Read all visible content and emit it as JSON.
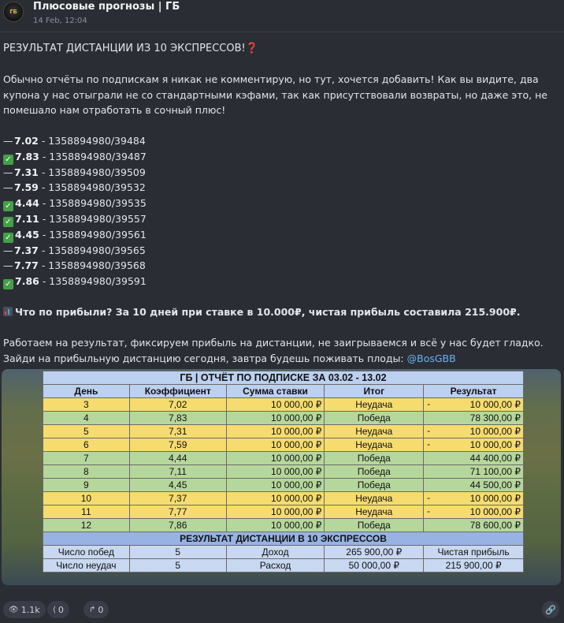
{
  "channel": {
    "title": "Плюсовые прогнозы | ГБ",
    "date": "14 Feb, 12:04",
    "avatar_icon": "channel-logo-icon"
  },
  "post": {
    "headline": "РЕЗУЛЬТАТ ДИСТАНЦИИ ИЗ 10 ЭКСПРЕССОВ!",
    "headline_emoji": "❓",
    "intro": "Обычно отчёты по подпискам я никак не комментирую, но тут, хочется добавить! Как вы видите, два купона у нас отыграли не со стандартными кэфами, так как присутствовали возвраты, но даже это, не помешало нам отработать в сочный плюс!",
    "bets": [
      {
        "status": "dash",
        "mark": "—",
        "coef": "7.02",
        "id": "- 1358894980/39484"
      },
      {
        "status": "check",
        "mark": "✓",
        "coef": "7.83",
        "id": "- 1358894980/39487"
      },
      {
        "status": "dash",
        "mark": "—",
        "coef": "7.31",
        "id": "- 1358894980/39509"
      },
      {
        "status": "dash",
        "mark": "—",
        "coef": "7.59",
        "id": "- 1358894980/39532"
      },
      {
        "status": "check",
        "mark": "✓",
        "coef": "4.44",
        "id": "- 1358894980/39535"
      },
      {
        "status": "check",
        "mark": "✓",
        "coef": "7.11",
        "id": "- 1358894980/39557"
      },
      {
        "status": "check",
        "mark": "✓",
        "coef": "4.45",
        "id": "- 1358894980/39561"
      },
      {
        "status": "dash",
        "mark": "—",
        "coef": "7.37",
        "id": "- 1358894980/39565"
      },
      {
        "status": "dash",
        "mark": "—",
        "coef": "7.77",
        "id": "- 1358894980/39568"
      },
      {
        "status": "check",
        "mark": "✓",
        "coef": "7.86",
        "id": "- 1358894980/39591"
      }
    ],
    "profit_line": "Что по прибыли? За 10 дней при ставке в 10.000₽, чистая прибыль составила 215.900₽.",
    "outro": "Работаем на результат, фиксируем прибыль на дистанции, не заигрываемся и всё у нас будет гладко. Зайди на прибыльную дистанцию сегодня, завтра будешь поживать плоды: ",
    "mention": "@BosGBB"
  },
  "report": {
    "title": "ГБ | ОТЧЁТ ПО ПОДПИСКЕ ЗА 03.02 - 13.02",
    "headers": [
      "День",
      "Коэффициент",
      "Сумма ставки",
      "Итог",
      "Результат"
    ],
    "rows": [
      {
        "day": "3",
        "coef": "7,02",
        "stake": "10 000,00 ₽",
        "outcome": "Неудача",
        "sign": "-",
        "result": "10 000,00 ₽",
        "win": false
      },
      {
        "day": "4",
        "coef": "7,83",
        "stake": "10 000,00 ₽",
        "outcome": "Победа",
        "sign": "",
        "result": "78 300,00 ₽",
        "win": true
      },
      {
        "day": "5",
        "coef": "7,31",
        "stake": "10 000,00 ₽",
        "outcome": "Неудача",
        "sign": "-",
        "result": "10 000,00 ₽",
        "win": false
      },
      {
        "day": "6",
        "coef": "7,59",
        "stake": "10 000,00 ₽",
        "outcome": "Неудача",
        "sign": "-",
        "result": "10 000,00 ₽",
        "win": false
      },
      {
        "day": "7",
        "coef": "4,44",
        "stake": "10 000,00 ₽",
        "outcome": "Победа",
        "sign": "",
        "result": "44 400,00 ₽",
        "win": true
      },
      {
        "day": "8",
        "coef": "7,11",
        "stake": "10 000,00 ₽",
        "outcome": "Победа",
        "sign": "",
        "result": "71 100,00 ₽",
        "win": true
      },
      {
        "day": "9",
        "coef": "4,45",
        "stake": "10 000,00 ₽",
        "outcome": "Победа",
        "sign": "",
        "result": "44 500,00 ₽",
        "win": true
      },
      {
        "day": "10",
        "coef": "7,37",
        "stake": "10 000,00 ₽",
        "outcome": "Неудача",
        "sign": "-",
        "result": "10 000,00 ₽",
        "win": false
      },
      {
        "day": "11",
        "coef": "7,77",
        "stake": "10 000,00 ₽",
        "outcome": "Неудача",
        "sign": "-",
        "result": "10 000,00 ₽",
        "win": false
      },
      {
        "day": "12",
        "coef": "7,86",
        "stake": "10 000,00 ₽",
        "outcome": "Победа",
        "sign": "",
        "result": "78 600,00 ₽",
        "win": true
      }
    ],
    "summary_title": "РЕЗУЛЬТАТ ДИСТАНЦИИ В 10 ЭКСПРЕССОВ",
    "summary": [
      {
        "label": "Число побед",
        "count": "5",
        "money_label": "Доход",
        "money": "265 900,00 ₽",
        "extra": "Чистая прибыль"
      },
      {
        "label": "Число неудач",
        "count": "5",
        "money_label": "Расход",
        "money": "50 000,00 ₽",
        "extra": "215 900,00 ₽"
      }
    ],
    "colors": {
      "lose": "#f6dc6e",
      "win": "#b6d79c",
      "header": "#bcd0ef",
      "summary": "#c9d8f1"
    }
  },
  "footer": {
    "views": "1.1k",
    "views_icon": "eye-icon",
    "reactions": "0",
    "reactions_icon": "share-icon",
    "forwards": "0",
    "forwards_icon": "forward-icon",
    "link_icon": "link-icon"
  }
}
